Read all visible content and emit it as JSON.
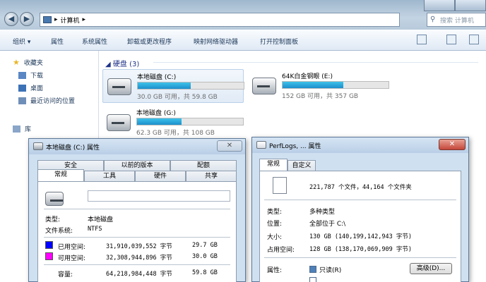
{
  "explorer": {
    "address_path": "计算机",
    "search_placeholder": "搜索 计算机",
    "toolbar": [
      "组织 ▾",
      "属性",
      "系统属性",
      "卸载或更改程序",
      "映射网络驱动器",
      "打开控制面板"
    ],
    "nav": {
      "favorites": "收藏夹",
      "downloads": "下载",
      "desktop": "桌面",
      "recent": "最近访问的位置",
      "libraries": "库"
    },
    "group_header": "硬盘 (3)",
    "drives": [
      {
        "name": "本地磁盘 (C:)",
        "free": "30.0 GB 可用，共 59.8 GB",
        "used_fraction": 0.5
      },
      {
        "name": "64K白金钢眼 (E:)",
        "free": "152 GB 可用，共 357 GB",
        "used_fraction": 0.57
      },
      {
        "name": "本地磁盘 (G:)",
        "free": "62.3 GB 可用，共 108 GB",
        "used_fraction": 0.42
      }
    ],
    "accent_color": "#26a0da"
  },
  "dlg_c": {
    "title": "本地磁盘 (C:) 属性",
    "tabs_row1": [
      "安全",
      "以前的版本",
      "配额"
    ],
    "tabs_row2": [
      "常规",
      "工具",
      "硬件",
      "共享"
    ],
    "type_label": "类型:",
    "type_value": "本地磁盘",
    "fs_label": "文件系统:",
    "fs_value": "NTFS",
    "used_label": "已用空间:",
    "used_bytes": "31,910,039,552 字节",
    "used_gb": "29.7 GB",
    "used_color": "#0000ff",
    "free_label": "可用空间:",
    "free_bytes": "32,308,944,896 字节",
    "free_gb": "30.0 GB",
    "free_color": "#ff00ff",
    "cap_label": "容量:",
    "cap_bytes": "64,218,984,448 字节",
    "cap_gb": "59.8 GB"
  },
  "dlg_p": {
    "title": "PerfLogs, ... 属性",
    "tabs": [
      "常规",
      "自定义"
    ],
    "summary": "221,787 个文件，44,164 个文件夹",
    "type_label": "类型:",
    "type_value": "多种类型",
    "loc_label": "位置:",
    "loc_value": "全部位于 C:\\",
    "size_label": "大小:",
    "size_value": "130 GB (140,199,142,943 字节)",
    "disk_label": "占用空间:",
    "disk_value": "128 GB (138,170,069,909 字节)",
    "attr_label": "属性:",
    "readonly_label": "只读(R)",
    "advanced_label": "高级(D)..."
  }
}
